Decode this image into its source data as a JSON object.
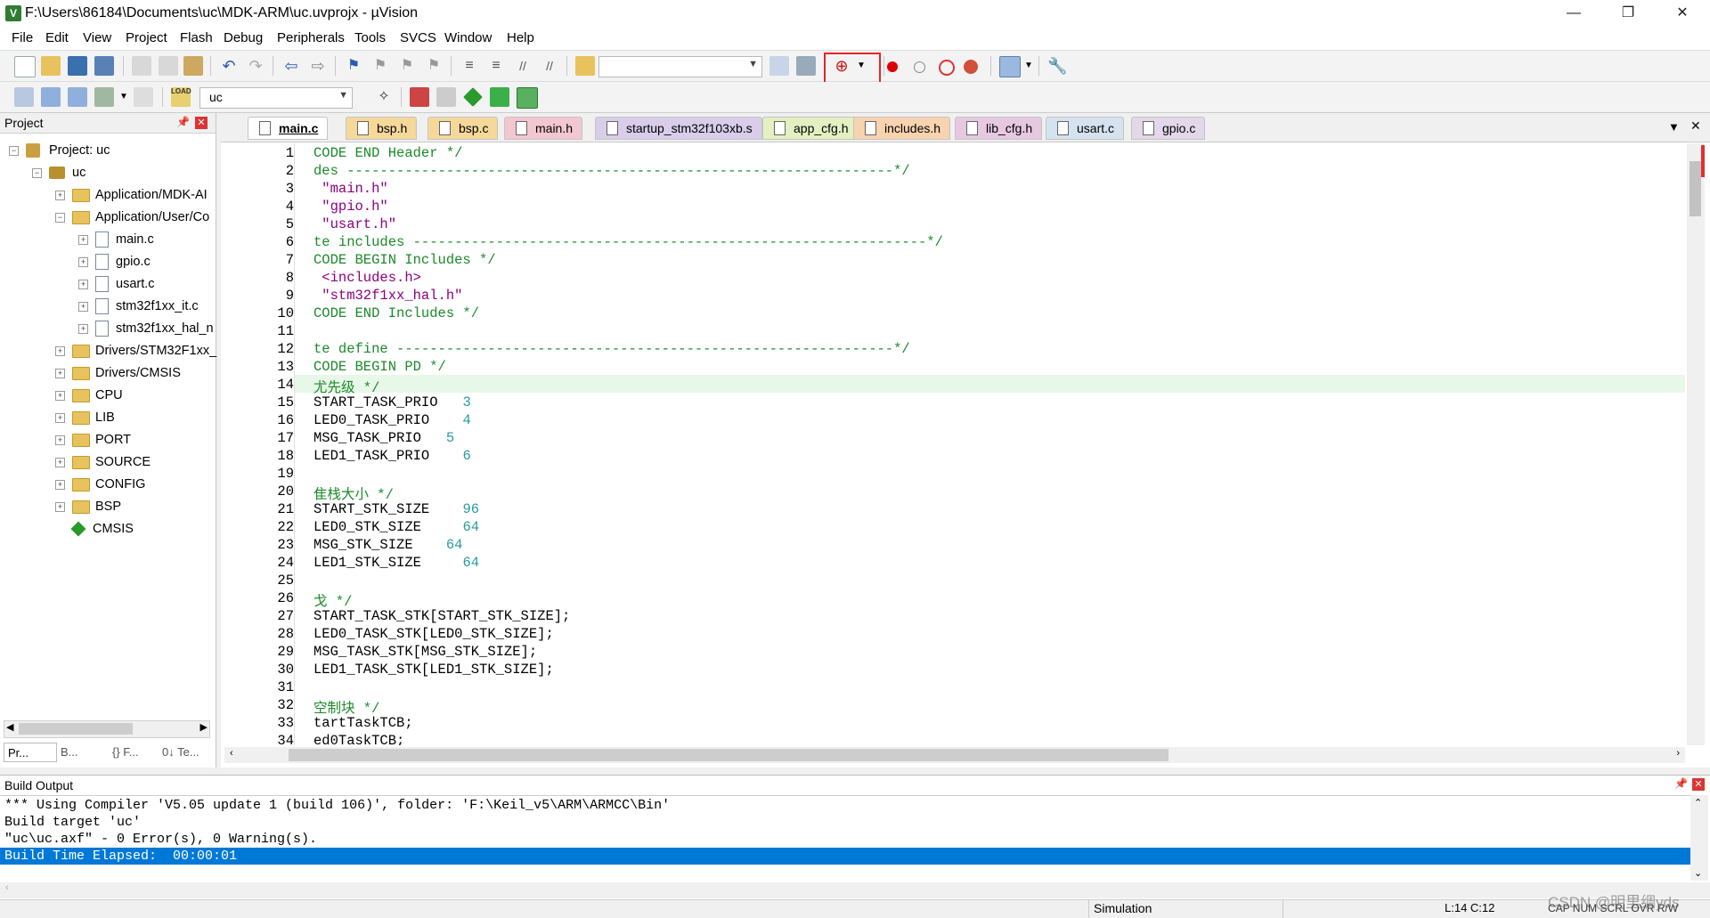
{
  "window": {
    "title": "F:\\Users\\86184\\Documents\\uc\\MDK-ARM\\uc.uvprojx - µVision",
    "minimize": "—",
    "maximize": "❐",
    "close": "✕"
  },
  "menu": [
    "File",
    "Edit",
    "View",
    "Project",
    "Flash",
    "Debug",
    "Peripherals",
    "Tools",
    "SVCS",
    "Window",
    "Help"
  ],
  "toolbar2": {
    "target": "uc",
    "load_label": "LOAD"
  },
  "project_panel": {
    "title": "Project",
    "tree": [
      {
        "label": "Project: uc",
        "kind": "root"
      },
      {
        "label": "uc",
        "kind": "target"
      },
      {
        "label": "Application/MDK-AI",
        "kind": "folder"
      },
      {
        "label": "Application/User/Co",
        "kind": "folder"
      },
      {
        "label": "main.c",
        "kind": "file"
      },
      {
        "label": "gpio.c",
        "kind": "file"
      },
      {
        "label": "usart.c",
        "kind": "file"
      },
      {
        "label": "stm32f1xx_it.c",
        "kind": "file"
      },
      {
        "label": "stm32f1xx_hal_n",
        "kind": "file"
      },
      {
        "label": "Drivers/STM32F1xx_",
        "kind": "folder"
      },
      {
        "label": "Drivers/CMSIS",
        "kind": "folder"
      },
      {
        "label": "CPU",
        "kind": "folder"
      },
      {
        "label": "LIB",
        "kind": "folder"
      },
      {
        "label": "PORT",
        "kind": "folder"
      },
      {
        "label": "SOURCE",
        "kind": "folder"
      },
      {
        "label": "CONFIG",
        "kind": "folder"
      },
      {
        "label": "BSP",
        "kind": "folder"
      },
      {
        "label": "CMSIS",
        "kind": "component"
      }
    ],
    "bottom_tabs": [
      "Pr...",
      "B...",
      "{} F...",
      "0↓ Te..."
    ]
  },
  "editor_tabs": [
    {
      "label": "main.c",
      "color": "#f3f3f3",
      "active": true
    },
    {
      "label": "bsp.h",
      "color": "#f5d89a"
    },
    {
      "label": "bsp.c",
      "color": "#f5d89a"
    },
    {
      "label": "main.h",
      "color": "#f3c7cf"
    },
    {
      "label": "startup_stm32f103xb.s",
      "color": "#d9cdea"
    },
    {
      "label": "app_cfg.h",
      "color": "#e3f0c2"
    },
    {
      "label": "includes.h",
      "color": "#f8d3b0"
    },
    {
      "label": "lib_cfg.h",
      "color": "#e6c8e0"
    },
    {
      "label": "usart.c",
      "color": "#d5e2f0"
    },
    {
      "label": "gpio.c",
      "color": "#e3d7ea"
    }
  ],
  "code_lines": [
    [
      [
        "CODE END Header */",
        "cm"
      ]
    ],
    [
      [
        "des ------------------------------------------------------------------*/",
        "cm"
      ]
    ],
    [
      [
        " \"main.h\"",
        "str"
      ]
    ],
    [
      [
        " \"gpio.h\"",
        "str"
      ]
    ],
    [
      [
        " \"usart.h\"",
        "str"
      ]
    ],
    [
      [
        "te includes --------------------------------------------------------------*/",
        "cm"
      ]
    ],
    [
      [
        "CODE BEGIN Includes */",
        "cm"
      ]
    ],
    [
      [
        " <includes.h>",
        "str"
      ]
    ],
    [
      [
        " \"stm32f1xx_hal.h\"",
        "str"
      ]
    ],
    [
      [
        "CODE END Includes */",
        "cm"
      ]
    ],
    [],
    [
      [
        "te define ------------------------------------------------------------*/",
        "cm"
      ]
    ],
    [
      [
        "CODE BEGIN PD */",
        "cm"
      ]
    ],
    [
      [
        "尤先级 */",
        "cm"
      ]
    ],
    [
      [
        "START_TASK_PRIO   ",
        ""
      ],
      [
        "3",
        "num"
      ]
    ],
    [
      [
        "LED0_TASK_PRIO    ",
        ""
      ],
      [
        "4",
        "num"
      ]
    ],
    [
      [
        "MSG_TASK_PRIO   ",
        ""
      ],
      [
        "5",
        "num"
      ]
    ],
    [
      [
        "LED1_TASK_PRIO    ",
        ""
      ],
      [
        "6",
        "num"
      ]
    ],
    [],
    [
      [
        "隹栈大小 */",
        "cm"
      ]
    ],
    [
      [
        "START_STK_SIZE    ",
        ""
      ],
      [
        "96",
        "num"
      ]
    ],
    [
      [
        "LED0_STK_SIZE     ",
        ""
      ],
      [
        "64",
        "num"
      ]
    ],
    [
      [
        "MSG_STK_SIZE    ",
        ""
      ],
      [
        "64",
        "num"
      ]
    ],
    [
      [
        "LED1_STK_SIZE     ",
        ""
      ],
      [
        "64",
        "num"
      ]
    ],
    [],
    [
      [
        "戈 */",
        "cm"
      ]
    ],
    [
      [
        "START_TASK_STK[START_STK_SIZE];",
        ""
      ]
    ],
    [
      [
        "LED0_TASK_STK[LED0_STK_SIZE];",
        ""
      ]
    ],
    [
      [
        "MSG_TASK_STK[MSG_STK_SIZE];",
        ""
      ]
    ],
    [
      [
        "LED1_TASK_STK[LED1_STK_SIZE];",
        ""
      ]
    ],
    [],
    [
      [
        "空制块 */",
        "cm"
      ]
    ],
    [
      [
        "tartTaskTCB;",
        ""
      ]
    ],
    [
      [
        "ed0TaskTCB;",
        ""
      ]
    ]
  ],
  "highlight_line": 14,
  "build_output": {
    "title": "Build Output",
    "lines": [
      "*** Using Compiler 'V5.05 update 1 (build 106)', folder: 'F:\\Keil_v5\\ARM\\ARMCC\\Bin'",
      "Build target 'uc'",
      "\"uc\\uc.axf\" - 0 Error(s), 0 Warning(s).",
      "Build Time Elapsed:  00:00:01"
    ]
  },
  "status": {
    "mode": "Simulation",
    "cursor": "L:14 C:12",
    "flags": "CAP NUM SCRL OVR R/W",
    "watermark": "CSDN @明里绸yds"
  },
  "colors": {
    "selection": "#0078d7",
    "comment": "#1b8a2a",
    "string": "#8b0080",
    "number": "#2a9aa0",
    "highlight_row": "#e8f8e8"
  }
}
